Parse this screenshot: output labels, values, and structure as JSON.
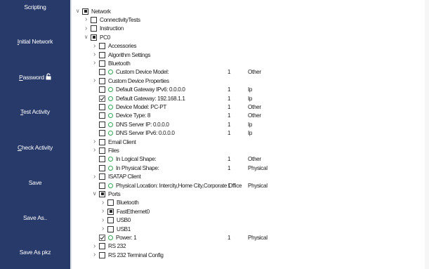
{
  "sidebar": {
    "buttons": [
      {
        "label": "Scripting"
      },
      {
        "label": "Initial Network",
        "accel": "I",
        "rest": "nitial Network"
      },
      {
        "label": "Password",
        "accel": "P",
        "rest": "assword"
      },
      {
        "label": "Test Activity",
        "accel": "T",
        "rest": "est Activity"
      },
      {
        "label": "Check Activity",
        "accel": "C",
        "rest": "heck Activity"
      },
      {
        "label": "Save"
      },
      {
        "label": "Save As.."
      },
      {
        "label": "Save As pkz"
      }
    ]
  },
  "tree": {
    "rows": [
      {
        "label": "Network",
        "check": "partial",
        "twisty": "open"
      },
      {
        "label": "ConnectivityTests",
        "check": "empty",
        "twisty": "closed"
      },
      {
        "label": "Instruction",
        "check": "empty",
        "twisty": "closed"
      },
      {
        "label": "PC0",
        "check": "partial",
        "twisty": "open"
      },
      {
        "label": "Accessories",
        "check": "empty",
        "twisty": "closed"
      },
      {
        "label": "Algorithm Settings",
        "check": "empty",
        "twisty": "closed"
      },
      {
        "label": "Bluetooth",
        "check": "empty",
        "twisty": "closed"
      },
      {
        "label": "Custom Device Model:",
        "check": "empty",
        "twisty": "none",
        "dot": true,
        "c1": "1",
        "c2": "Other"
      },
      {
        "label": "Custom Device Properties",
        "check": "empty",
        "twisty": "closed"
      },
      {
        "label": "Default Gateway IPv6: 0.0.0.0",
        "check": "empty",
        "twisty": "none",
        "dot": true,
        "c1": "1",
        "c2": "Ip"
      },
      {
        "label": "Default Gateway: 192.168.1.1",
        "check": "checked",
        "twisty": "none",
        "dot": true,
        "c1": "1",
        "c2": "Ip"
      },
      {
        "label": "Device Model: PC-PT",
        "check": "empty",
        "twisty": "none",
        "dot": true,
        "c1": "1",
        "c2": "Other"
      },
      {
        "label": "Device Type: 8",
        "check": "empty",
        "twisty": "none",
        "dot": true,
        "c1": "1",
        "c2": "Other"
      },
      {
        "label": "DNS Server IP: 0.0.0.0",
        "check": "empty",
        "twisty": "none",
        "dot": true,
        "c1": "1",
        "c2": "Ip"
      },
      {
        "label": "DNS Server IPv6: 0.0.0.0",
        "check": "empty",
        "twisty": "none",
        "dot": true,
        "c1": "1",
        "c2": "Ip"
      },
      {
        "label": "Email Client",
        "check": "empty",
        "twisty": "closed"
      },
      {
        "label": "Files",
        "check": "empty",
        "twisty": "closed"
      },
      {
        "label": "In Logical Shape:",
        "check": "empty",
        "twisty": "none",
        "dot": true,
        "c1": "1",
        "c2": "Other"
      },
      {
        "label": "In Physical Shape:",
        "check": "empty",
        "twisty": "none",
        "dot": true,
        "c1": "1",
        "c2": "Physical"
      },
      {
        "label": "ISATAP Client",
        "check": "empty",
        "twisty": "closed"
      },
      {
        "label": "Physical Location: Intercity,Home City,Corporate Office",
        "check": "empty",
        "twisty": "none",
        "dot": true,
        "c1": "1",
        "c2": "Physical"
      },
      {
        "label": "Ports",
        "check": "partial",
        "twisty": "open"
      },
      {
        "label": "Bluetooth",
        "check": "empty",
        "twisty": "closed"
      },
      {
        "label": "FastEthernet0",
        "check": "partial",
        "twisty": "closed"
      },
      {
        "label": "USB0",
        "check": "empty",
        "twisty": "closed"
      },
      {
        "label": "USB1",
        "check": "empty",
        "twisty": "closed"
      },
      {
        "label": "Power: 1",
        "check": "checked",
        "twisty": "none",
        "dot": true,
        "c1": "1",
        "c2": "Physical"
      },
      {
        "label": "RS 232",
        "check": "empty",
        "twisty": "closed"
      },
      {
        "label": "RS 232 Terminal Config",
        "check": "empty",
        "twisty": "closed"
      }
    ]
  }
}
